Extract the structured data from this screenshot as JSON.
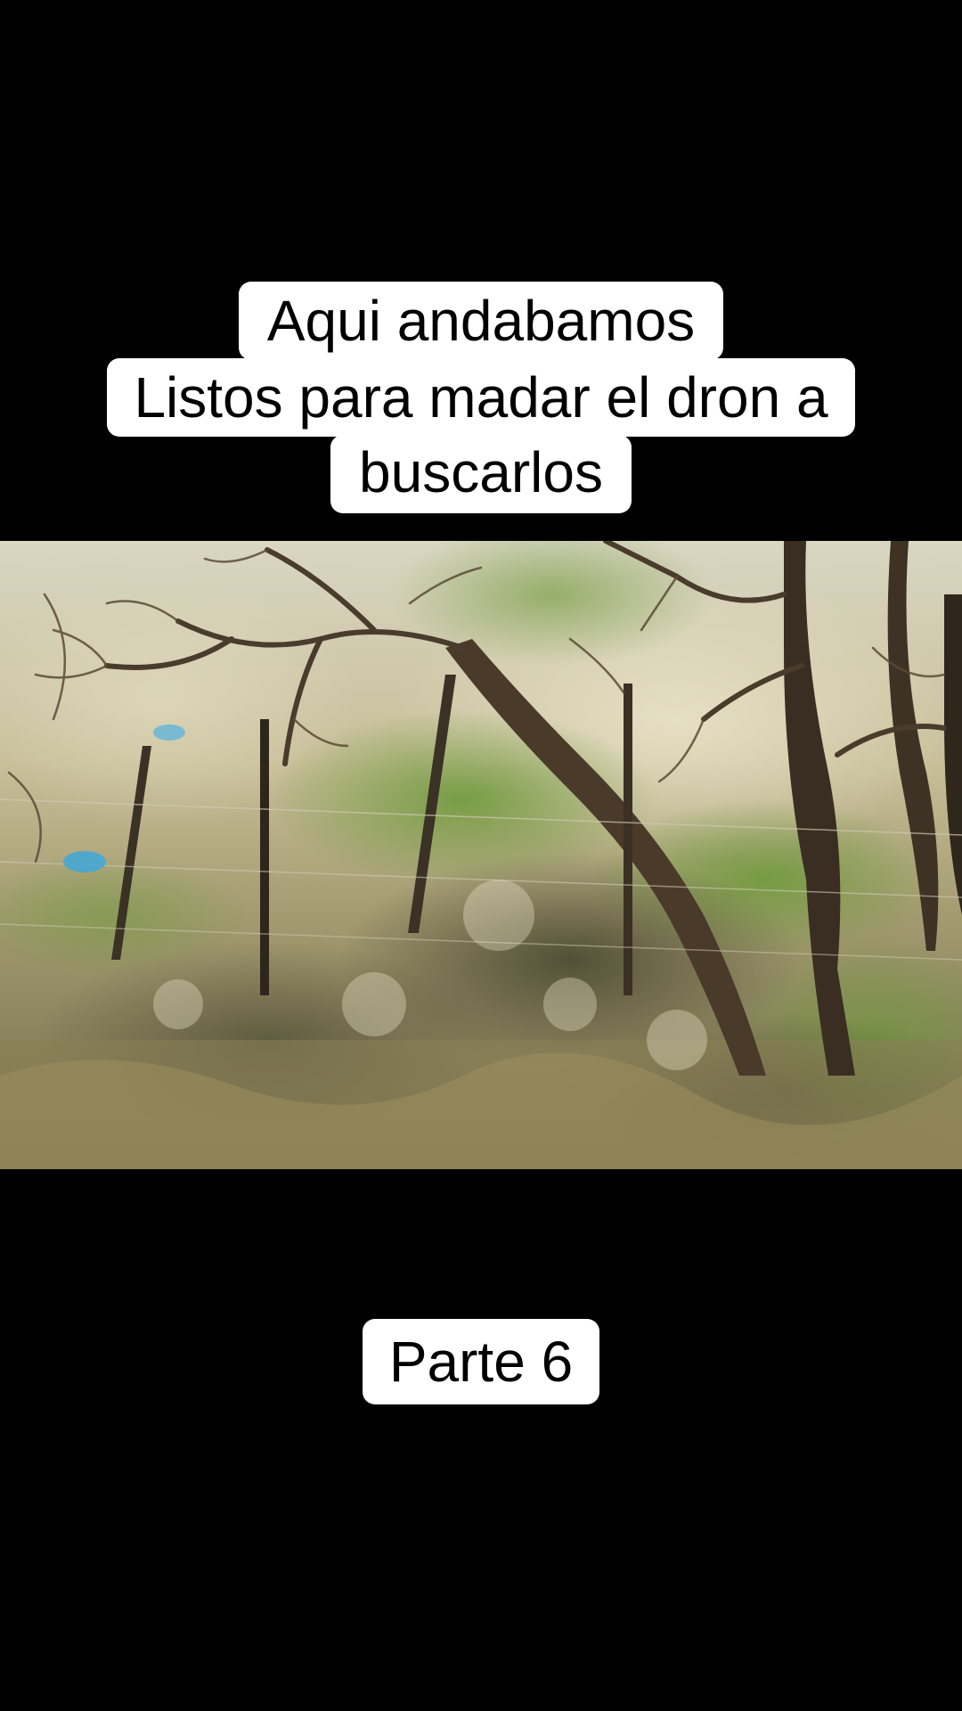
{
  "caption": {
    "lines": [
      "Aqui andabamos",
      "Listos para madar el dron a",
      "buscarlos"
    ]
  },
  "part_label": "Parte 6",
  "colors": {
    "background": "#000000",
    "caption_bg": "#ffffff",
    "caption_text": "#000000"
  }
}
